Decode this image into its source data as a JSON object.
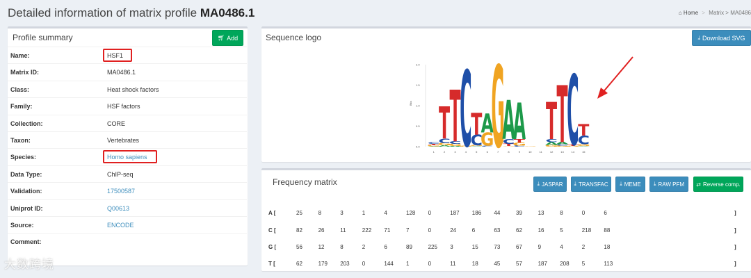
{
  "page": {
    "title_prefix": "Detailed information of matrix profile ",
    "matrix_id": "MA0486.1"
  },
  "breadcrumb": {
    "home": "Home",
    "sep": ">",
    "matrix": "Matrix > MA0486"
  },
  "summary": {
    "title": "Profile summary",
    "add_label": "Add",
    "rows": [
      {
        "key": "Name:",
        "value": "HSF1",
        "link": false,
        "highlight": true
      },
      {
        "key": "Matrix ID:",
        "value": "MA0486.1",
        "link": false,
        "highlight": false
      },
      {
        "key": "Class:",
        "value": "Heat shock factors",
        "link": false,
        "highlight": false
      },
      {
        "key": "Family:",
        "value": "HSF factors",
        "link": false,
        "highlight": false
      },
      {
        "key": "Collection:",
        "value": "CORE",
        "link": false,
        "highlight": false
      },
      {
        "key": "Taxon:",
        "value": "Vertebrates",
        "link": false,
        "highlight": false
      },
      {
        "key": "Species:",
        "value": "Homo sapiens",
        "link": true,
        "highlight": true
      },
      {
        "key": "Data Type:",
        "value": "ChIP-seq",
        "link": false,
        "highlight": false
      },
      {
        "key": "Validation:",
        "value": "17500587",
        "link": true,
        "highlight": false
      },
      {
        "key": "Uniprot ID:",
        "value": "Q00613",
        "link": true,
        "highlight": false
      },
      {
        "key": "Source:",
        "value": "ENCODE",
        "link": true,
        "highlight": false
      },
      {
        "key": "Comment:",
        "value": "",
        "link": false,
        "highlight": false
      }
    ]
  },
  "logo": {
    "title": "Sequence logo",
    "download_label": "Download SVG",
    "y_axis_label": "Bits",
    "y_ticks": [
      "0.0",
      "0.5",
      "1.0",
      "1.5",
      "2.0"
    ],
    "positions": [
      "1",
      "2",
      "3",
      "4",
      "5",
      "6",
      "7",
      "8",
      "9",
      "10",
      "11",
      "12",
      "13",
      "14",
      "15"
    ],
    "colors": {
      "A": "#1d9a4a",
      "C": "#1f4fa8",
      "G": "#f0a422",
      "T": "#d62b2b"
    }
  },
  "frequency": {
    "title": "Frequency matrix",
    "buttons": [
      "JASPAR",
      "TRANSFAC",
      "MEME",
      "RAW PFM",
      "Reverse comp."
    ],
    "open_bracket": "[",
    "close_bracket": "]",
    "rows": [
      {
        "base": "A",
        "values": [
          25,
          8,
          3,
          1,
          4,
          128,
          0,
          187,
          186,
          44,
          39,
          13,
          8,
          0,
          6
        ]
      },
      {
        "base": "C",
        "values": [
          82,
          26,
          11,
          222,
          71,
          7,
          0,
          24,
          6,
          63,
          62,
          16,
          5,
          218,
          88
        ]
      },
      {
        "base": "G",
        "values": [
          56,
          12,
          8,
          2,
          6,
          89,
          225,
          3,
          15,
          73,
          67,
          9,
          4,
          2,
          18
        ]
      },
      {
        "base": "T",
        "values": [
          62,
          179,
          203,
          0,
          144,
          1,
          0,
          11,
          18,
          45,
          57,
          187,
          208,
          5,
          113
        ]
      }
    ]
  },
  "watermark": "大数跨境",
  "colors": {
    "accent_blue": "#3c8dbc",
    "accent_green": "#00a65a",
    "highlight_red": "#e02020"
  }
}
